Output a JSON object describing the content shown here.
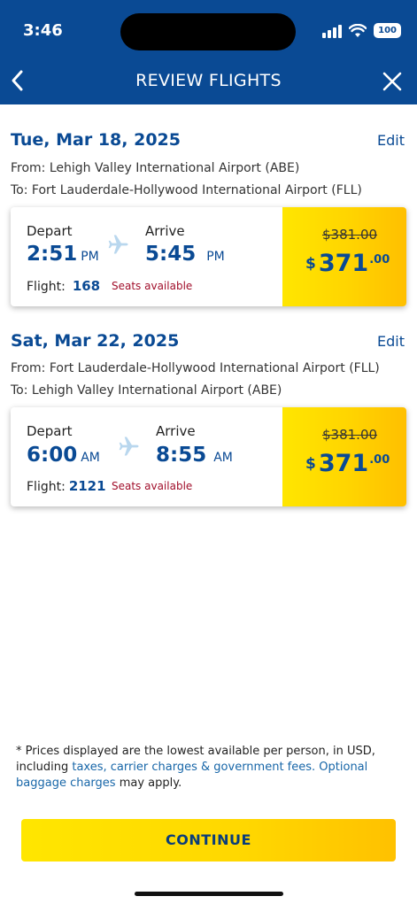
{
  "status": {
    "time": "3:46",
    "battery": "100"
  },
  "nav": {
    "title": "REVIEW FLIGHTS"
  },
  "flights": [
    {
      "date": "Tue, Mar 18, 2025",
      "edit": "Edit",
      "from": "From: Lehigh Valley International Airport (ABE)",
      "to": "To: Fort Lauderdale-Hollywood International Airport (FLL)",
      "depart_label": "Depart",
      "depart_time": "2:51",
      "depart_ampm": "PM",
      "arrive_label": "Arrive",
      "arrive_time": "5:45",
      "arrive_ampm": "PM",
      "flight_label": "Flight:",
      "flight_number": "168",
      "seats": "Seats available",
      "old_price": "$381.00",
      "price_currency": "$",
      "price_amount": "371",
      "price_cents": ".00"
    },
    {
      "date": "Sat, Mar 22, 2025",
      "edit": "Edit",
      "from": "From: Fort Lauderdale-Hollywood International Airport (FLL)",
      "to": "To: Lehigh Valley International Airport (ABE)",
      "depart_label": "Depart",
      "depart_time": "6:00",
      "depart_ampm": "AM",
      "arrive_label": "Arrive",
      "arrive_time": "8:55",
      "arrive_ampm": "AM",
      "flight_label": "Flight:",
      "flight_number": "2121",
      "seats": "Seats available",
      "old_price": "$381.00",
      "price_currency": "$",
      "price_amount": "371",
      "price_cents": ".00"
    }
  ],
  "disclaimer": {
    "text1": "* Prices displayed are the lowest available per person, in USD, including ",
    "link1": "taxes, carrier charges & government fees.",
    "text2": " ",
    "link2": "Optional baggage charges",
    "text3": " may apply."
  },
  "continue_label": "CONTINUE",
  "colors": {
    "brand_blue": "#0a4a94",
    "accent_yellow": "#ffd400",
    "seats_red": "#a10f2b"
  }
}
